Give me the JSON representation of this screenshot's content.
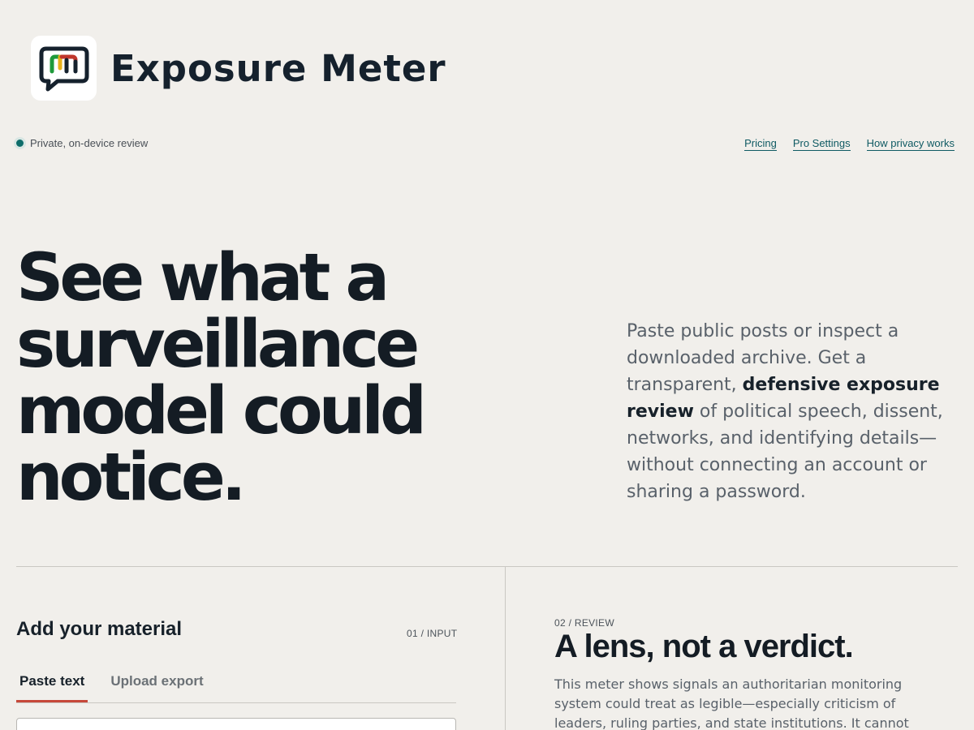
{
  "brand": {
    "name": "Exposure Meter",
    "logo_icon": "speech-bubble-meter-icon",
    "logo_colors": [
      "#1f9a3a",
      "#e9b21b",
      "#c0362b",
      "#15212d"
    ]
  },
  "status": {
    "text": "Private, on-device review",
    "dot_color": "#0e6d6a"
  },
  "nav": {
    "pricing": "Pricing",
    "pro_settings": "Pro Settings",
    "privacy": "How privacy works"
  },
  "hero": {
    "title": "See what a surveillance model could notice.",
    "desc_before": "Paste public posts or inspect a downloaded archive. Get a transparent, ",
    "desc_bold": "defensive exposure review",
    "desc_after": " of political speech, dissent, networks, and identifying details—without connecting an account or sharing a password."
  },
  "input_panel": {
    "title": "Add your material",
    "step": "01 / INPUT",
    "tabs": [
      "Paste text",
      "Upload export"
    ],
    "active_tab": "Paste text",
    "accent": "#c6483a"
  },
  "review_panel": {
    "step": "02 / REVIEW",
    "title": "A lens, not a verdict.",
    "body": "This meter shows signals an authoritarian monitoring system could treat as legible—especially criticism of leaders, ruling parties, and state institutions. It cannot predict what any real"
  }
}
